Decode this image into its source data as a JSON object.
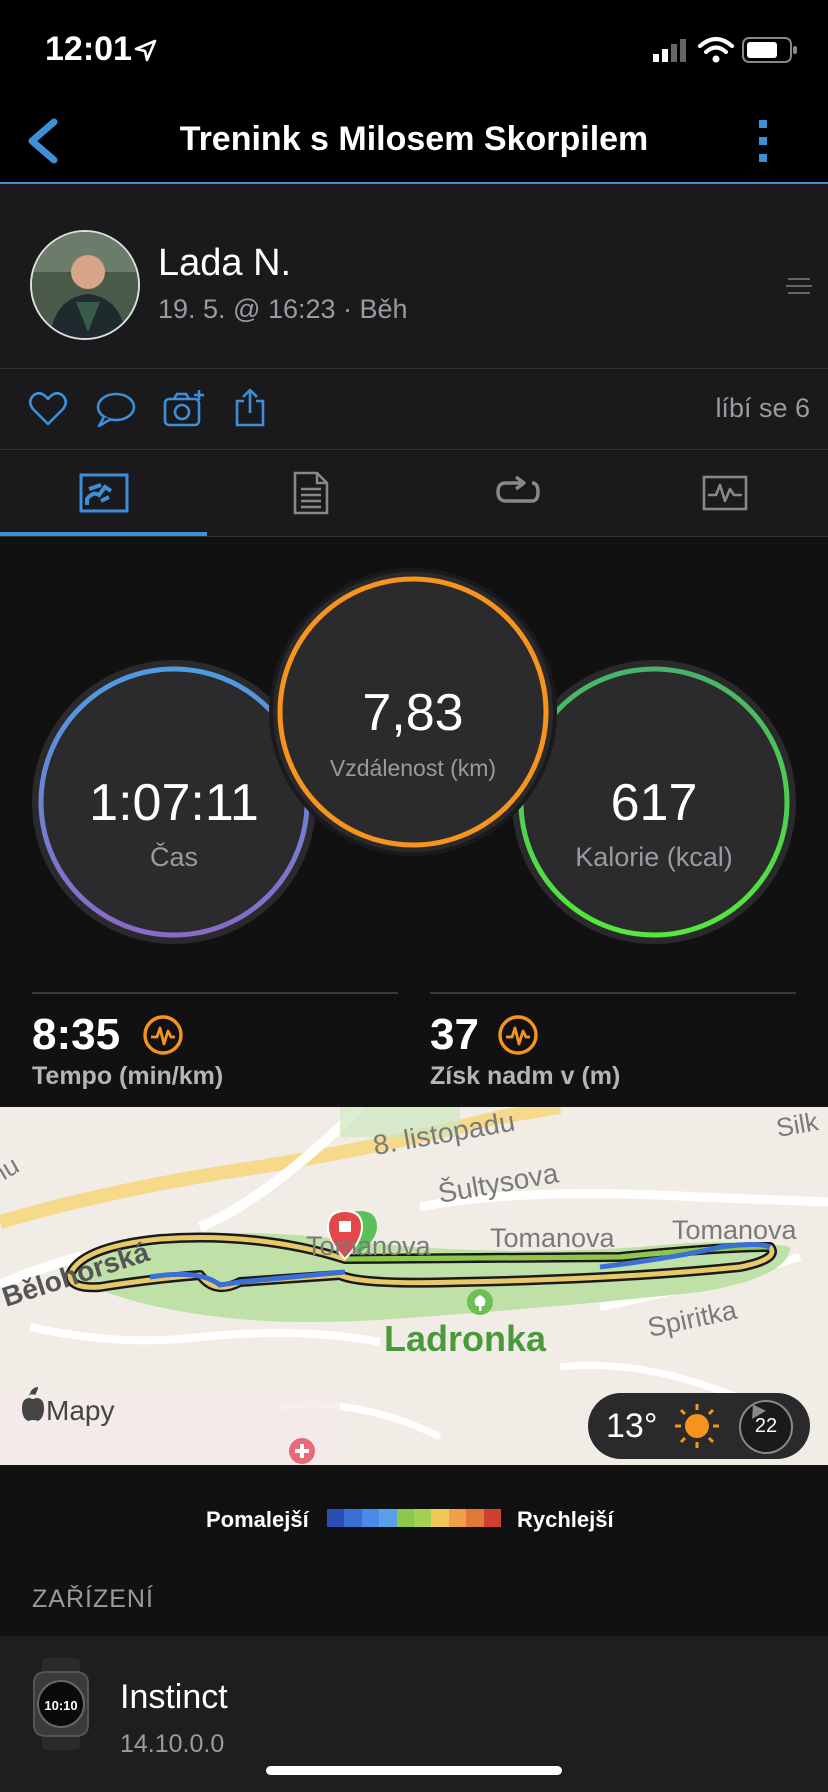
{
  "status": {
    "time": "12:01"
  },
  "nav": {
    "title": "Trenink s Milosem Skorpilem"
  },
  "profile": {
    "name": "Lada N.",
    "meta": "19. 5. @ 16:23 · Běh"
  },
  "actions": {
    "likes": "líbí se 6"
  },
  "stats": {
    "time": {
      "value": "1:07:11",
      "label": "Čas"
    },
    "distance": {
      "value": "7,83",
      "label": "Vzdálenost (km)"
    },
    "calories": {
      "value": "617",
      "label": "Kalorie (kcal)"
    },
    "pace": {
      "value": "8:35",
      "label": "Tempo (min/km)"
    },
    "elevation": {
      "value": "37",
      "label": "Získ nadm v (m)"
    }
  },
  "map": {
    "streets": [
      "8. listopadu",
      "Šultysova",
      "Bělohorská",
      "Tomanova",
      "Tomanova",
      "Tomanova",
      "Spiritka",
      "Silk",
      "hu"
    ],
    "park": "Ladronka",
    "attribution": "Mapy",
    "weather": {
      "temp": "13°",
      "wind": "22"
    }
  },
  "legend": {
    "slower": "Pomalejší",
    "faster": "Rychlejší",
    "colors": [
      "#2a4fb3",
      "#3a6fd6",
      "#4a8ae8",
      "#5aa0e8",
      "#8cc84b",
      "#a8d050",
      "#f0c85a",
      "#f0a048",
      "#e07838",
      "#d04030"
    ]
  },
  "device": {
    "header": "ZAŘÍZENÍ",
    "name": "Instinct",
    "version": "14.10.0.0",
    "watch_time": "10:10"
  },
  "colors": {
    "accent": "#3d8fd8",
    "orange": "#f7941d"
  }
}
